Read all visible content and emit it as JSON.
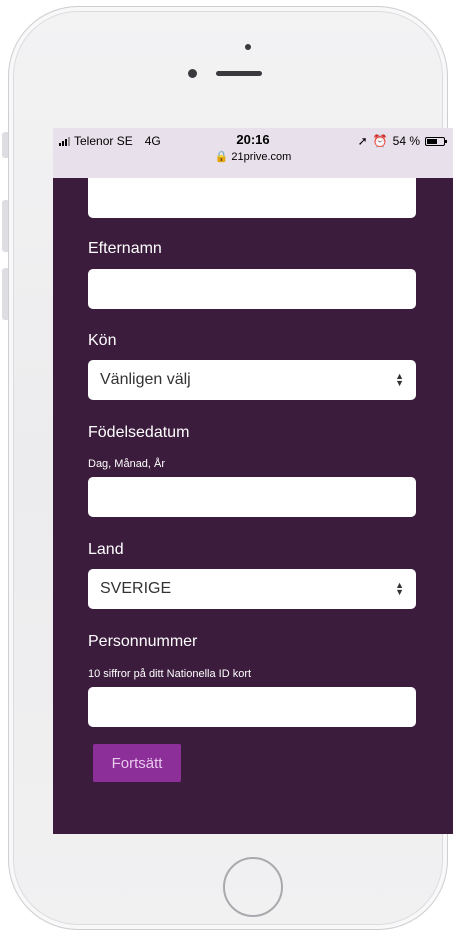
{
  "status_bar": {
    "carrier": "Telenor SE",
    "network": "4G",
    "time": "20:16",
    "battery": "54 %",
    "battery_level": 0.54,
    "url": "21prive.com",
    "icons": [
      "signal-icon",
      "lock-icon",
      "location-icon",
      "alarm-icon",
      "battery-icon"
    ]
  },
  "form": {
    "first_name_value": "",
    "last_name_label": "Efternamn",
    "last_name_value": "",
    "gender_label": "Kön",
    "gender_selected": "Vänligen välj",
    "birthdate_label": "Födelsedatum",
    "birthdate_hint": "Dag, Månad, År",
    "birthdate_value": "",
    "country_label": "Land",
    "country_selected": "SVERIGE",
    "personal_number_label": "Personnummer",
    "personal_number_hint": "10 siffror på ditt Nationella ID kort",
    "personal_number_value": "",
    "continue_button": "Fortsätt"
  },
  "colors": {
    "background": "#3b1c3d",
    "button": "#8d2f98",
    "button_text": "#e9c8ee",
    "status_bar": "#e8e0ea"
  }
}
